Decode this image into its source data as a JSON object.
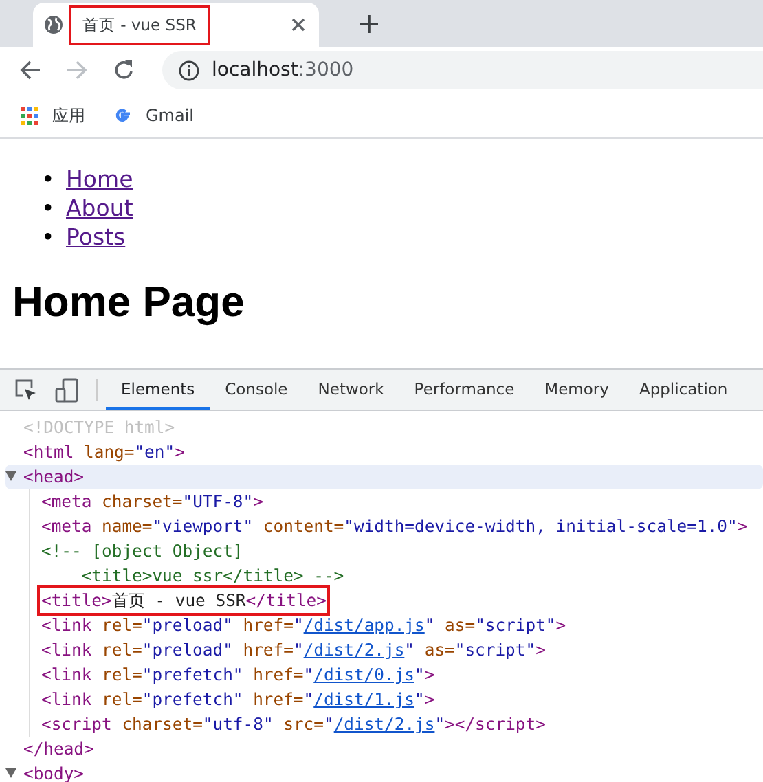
{
  "browser": {
    "tabs": [
      {
        "title": "首页 - vue SSR",
        "selected": true,
        "highlighted": true
      }
    ],
    "address": {
      "host": "localhost",
      "port": ":3000"
    },
    "bookmarks": [
      {
        "kind": "apps",
        "label": "应用"
      },
      {
        "kind": "google",
        "label": "Gmail"
      }
    ]
  },
  "page": {
    "nav": [
      {
        "marker": "•",
        "label": "Home"
      },
      {
        "marker": "•",
        "label": "About"
      },
      {
        "marker": "•",
        "label": "Posts"
      }
    ],
    "heading": "Home Page"
  },
  "devtools": {
    "tabs": [
      {
        "label": "Elements",
        "selected": true
      },
      {
        "label": "Console",
        "selected": false
      },
      {
        "label": "Network",
        "selected": false
      },
      {
        "label": "Performance",
        "selected": false
      },
      {
        "label": "Memory",
        "selected": false
      },
      {
        "label": "Application",
        "selected": false
      }
    ],
    "dom": [
      {
        "tokens": [
          {
            "kind": "doctype",
            "text": "<!DOCTYPE html>"
          }
        ]
      },
      {
        "tokens": [
          {
            "kind": "tag",
            "text": "<html"
          },
          {
            "kind": "attr",
            "text": " lang="
          },
          {
            "kind": "value",
            "text": "\"en\""
          },
          {
            "kind": "tag",
            "text": ">"
          }
        ],
        "children": [
          {
            "expanded": true,
            "selected": true,
            "tokens": [
              {
                "kind": "tag",
                "text": "<head>"
              }
            ],
            "closing": [
              {
                "kind": "tag",
                "text": "</head>"
              }
            ],
            "children": [
              {
                "tokens": [
                  {
                    "kind": "tag",
                    "text": "<meta"
                  },
                  {
                    "kind": "attr",
                    "text": " charset="
                  },
                  {
                    "kind": "value",
                    "text": "\"UTF-8\""
                  },
                  {
                    "kind": "tag",
                    "text": ">"
                  }
                ]
              },
              {
                "tokens": [
                  {
                    "kind": "tag",
                    "text": "<meta"
                  },
                  {
                    "kind": "attr",
                    "text": " name="
                  },
                  {
                    "kind": "value",
                    "text": "\"viewport\""
                  },
                  {
                    "kind": "attr",
                    "text": " content="
                  },
                  {
                    "kind": "value",
                    "text": "\"width=device-width, initial-scale=1.0\""
                  },
                  {
                    "kind": "tag",
                    "text": ">"
                  }
                ]
              },
              {
                "tokens": [
                  {
                    "kind": "comment",
                    "text": "<!-- [object Object]\n    <title>vue ssr</title> -->"
                  }
                ]
              },
              {
                "highlighted": true,
                "tokens": [
                  {
                    "kind": "tag",
                    "text": "<title>"
                  },
                  {
                    "kind": "text",
                    "text": "首页 - vue SSR"
                  },
                  {
                    "kind": "tag",
                    "text": "</title>"
                  }
                ]
              },
              {
                "tokens": [
                  {
                    "kind": "tag",
                    "text": "<link"
                  },
                  {
                    "kind": "attr",
                    "text": " rel="
                  },
                  {
                    "kind": "value",
                    "text": "\"preload\""
                  },
                  {
                    "kind": "attr",
                    "text": " href="
                  },
                  {
                    "kind": "value",
                    "text": "\""
                  },
                  {
                    "kind": "link",
                    "text": "/dist/app.js"
                  },
                  {
                    "kind": "value",
                    "text": "\""
                  },
                  {
                    "kind": "attr",
                    "text": " as="
                  },
                  {
                    "kind": "value",
                    "text": "\"script\""
                  },
                  {
                    "kind": "tag",
                    "text": ">"
                  }
                ]
              },
              {
                "tokens": [
                  {
                    "kind": "tag",
                    "text": "<link"
                  },
                  {
                    "kind": "attr",
                    "text": " rel="
                  },
                  {
                    "kind": "value",
                    "text": "\"preload\""
                  },
                  {
                    "kind": "attr",
                    "text": " href="
                  },
                  {
                    "kind": "value",
                    "text": "\""
                  },
                  {
                    "kind": "link",
                    "text": "/dist/2.js"
                  },
                  {
                    "kind": "value",
                    "text": "\""
                  },
                  {
                    "kind": "attr",
                    "text": " as="
                  },
                  {
                    "kind": "value",
                    "text": "\"script\""
                  },
                  {
                    "kind": "tag",
                    "text": ">"
                  }
                ]
              },
              {
                "tokens": [
                  {
                    "kind": "tag",
                    "text": "<link"
                  },
                  {
                    "kind": "attr",
                    "text": " rel="
                  },
                  {
                    "kind": "value",
                    "text": "\"prefetch\""
                  },
                  {
                    "kind": "attr",
                    "text": " href="
                  },
                  {
                    "kind": "value",
                    "text": "\""
                  },
                  {
                    "kind": "link",
                    "text": "/dist/0.js"
                  },
                  {
                    "kind": "value",
                    "text": "\""
                  },
                  {
                    "kind": "tag",
                    "text": ">"
                  }
                ]
              },
              {
                "tokens": [
                  {
                    "kind": "tag",
                    "text": "<link"
                  },
                  {
                    "kind": "attr",
                    "text": " rel="
                  },
                  {
                    "kind": "value",
                    "text": "\"prefetch\""
                  },
                  {
                    "kind": "attr",
                    "text": " href="
                  },
                  {
                    "kind": "value",
                    "text": "\""
                  },
                  {
                    "kind": "link",
                    "text": "/dist/1.js"
                  },
                  {
                    "kind": "value",
                    "text": "\""
                  },
                  {
                    "kind": "tag",
                    "text": ">"
                  }
                ]
              },
              {
                "tokens": [
                  {
                    "kind": "tag",
                    "text": "<script"
                  },
                  {
                    "kind": "attr",
                    "text": " charset="
                  },
                  {
                    "kind": "value",
                    "text": "\"utf-8\""
                  },
                  {
                    "kind": "attr",
                    "text": " src="
                  },
                  {
                    "kind": "value",
                    "text": "\""
                  },
                  {
                    "kind": "link",
                    "text": "/dist/2.js"
                  },
                  {
                    "kind": "value",
                    "text": "\""
                  },
                  {
                    "kind": "tag",
                    "text": "></script>"
                  }
                ]
              }
            ]
          },
          {
            "expanded": true,
            "tokens": [
              {
                "kind": "tag",
                "text": "<body>"
              }
            ]
          }
        ]
      }
    ]
  }
}
